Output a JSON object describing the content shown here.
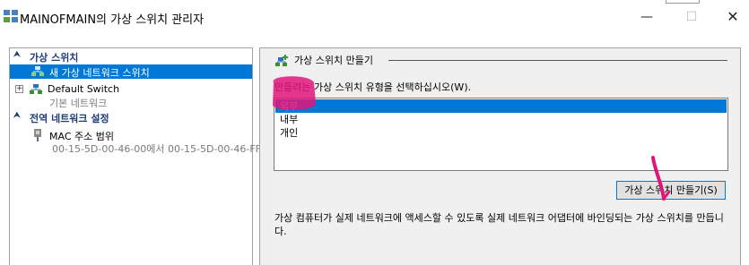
{
  "window": {
    "title": "MAINOFMAIN의 가상 스위치 관리자",
    "minimize_glyph": "—",
    "maximize_glyph": "☐",
    "close_glyph": "✕",
    "icon": "switch-manager-icon"
  },
  "sidebar": {
    "virtual_switches_header": "가상 스위치",
    "new_switch_item": "새 가상 네트워크 스위치",
    "default_switch": {
      "label": "Default Switch",
      "subtitle": "기본 네트워크",
      "expander": "+"
    },
    "global_settings_header": "전역 네트워크 설정",
    "mac_range": {
      "label": "MAC 주소 범위",
      "range_text": "00-15-5D-00-46-00에서 00-15-5D-00-46-FF"
    },
    "collapse_glyph": "⮝"
  },
  "main": {
    "group_title": "가상 스위치 만들기",
    "prompt": "만들려는 가상 스위치 유형을 선택하십시오(W).",
    "switch_types": [
      "외부",
      "내부",
      "개인"
    ],
    "selected_type": "외부",
    "create_button_label": "가상 스위치 만들기(S)",
    "description": "가상 컴퓨터가 실제 네트워크에 액세스할 수 있도록 실제 네트워크 어댑터에 바인딩되는 가상 스위치를 만듭니다."
  },
  "colors": {
    "selection": "#0078d7",
    "section_header": "#1e3c78",
    "annotation": "#e0157a"
  }
}
